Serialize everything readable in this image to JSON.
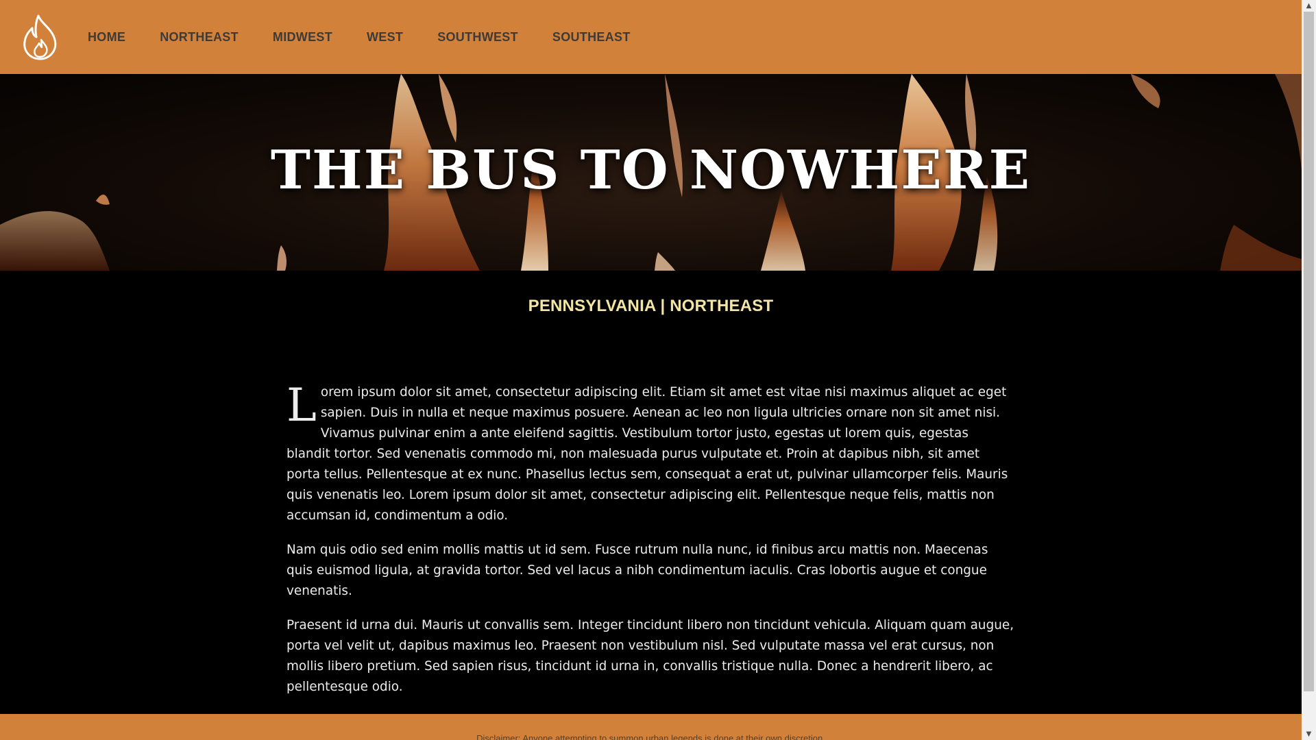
{
  "nav": {
    "logo_icon": "flame-icon",
    "links": [
      {
        "label": "HOME"
      },
      {
        "label": "NORTHEAST"
      },
      {
        "label": "MIDWEST"
      },
      {
        "label": "WEST"
      },
      {
        "label": "SOUTHWEST"
      },
      {
        "label": "SOUTHEAST"
      }
    ]
  },
  "hero": {
    "title": "THE BUS TO NOWHERE"
  },
  "article": {
    "location": "PENNSYLVANIA | NORTHEAST",
    "drop_cap": "L",
    "paragraphs": [
      "orem ipsum dolor sit amet, consectetur adipiscing elit. Etiam sit amet est vitae nisi maximus aliquet ac eget sapien. Duis in nulla et neque maximus posuere. Aenean ac leo non ligula ultricies ornare non sit amet nisi. Vivamus pulvinar enim a ante eleifend sagittis. Vestibulum tortor justo, egestas ut lorem quis, egestas blandit tortor. Sed venenatis commodo mi, non malesuada purus vulputate et. Proin at dapibus nibh, sit amet porta tellus. Pellentesque at ex nunc. Phasellus lectus sem, consequat a erat ut, pulvinar ullamcorper felis. Mauris quis venenatis leo. Lorem ipsum dolor sit amet, consectetur adipiscing elit. Pellentesque neque felis, mattis non accumsan id, condimentum a odio.",
      "Nam quis odio sed enim mollis mattis ut id sem. Fusce rutrum nulla nunc, id finibus arcu mattis non. Maecenas quis euismod ligula, at gravida tortor. Sed vel lacus a nibh condimentum iaculis. Cras lobortis augue et congue venenatis.",
      "Praesent id urna dui. Mauris ut convallis sem. Integer tincidunt libero non tincidunt vehicula. Aliquam quam augue, porta vel velit ut, dapibus maximus leo. Praesent non vestibulum nisl. Sed vulputate massa vel erat cursus, non mollis libero pretium. Sed sapien risus, tincidunt id urna in, convallis tristique nulla. Donec a hendrerit libero, ac pellentesque odio."
    ]
  },
  "footer": {
    "disclaimer": "Disclaimer: Anyone attempting to summon urban legends is done at their own discretion."
  },
  "colors": {
    "nav_bg": "#d2813a",
    "nav_text": "#3f3a36",
    "location_text": "#f4e6a2",
    "body_bg": "#000000",
    "body_text": "#ececec"
  }
}
